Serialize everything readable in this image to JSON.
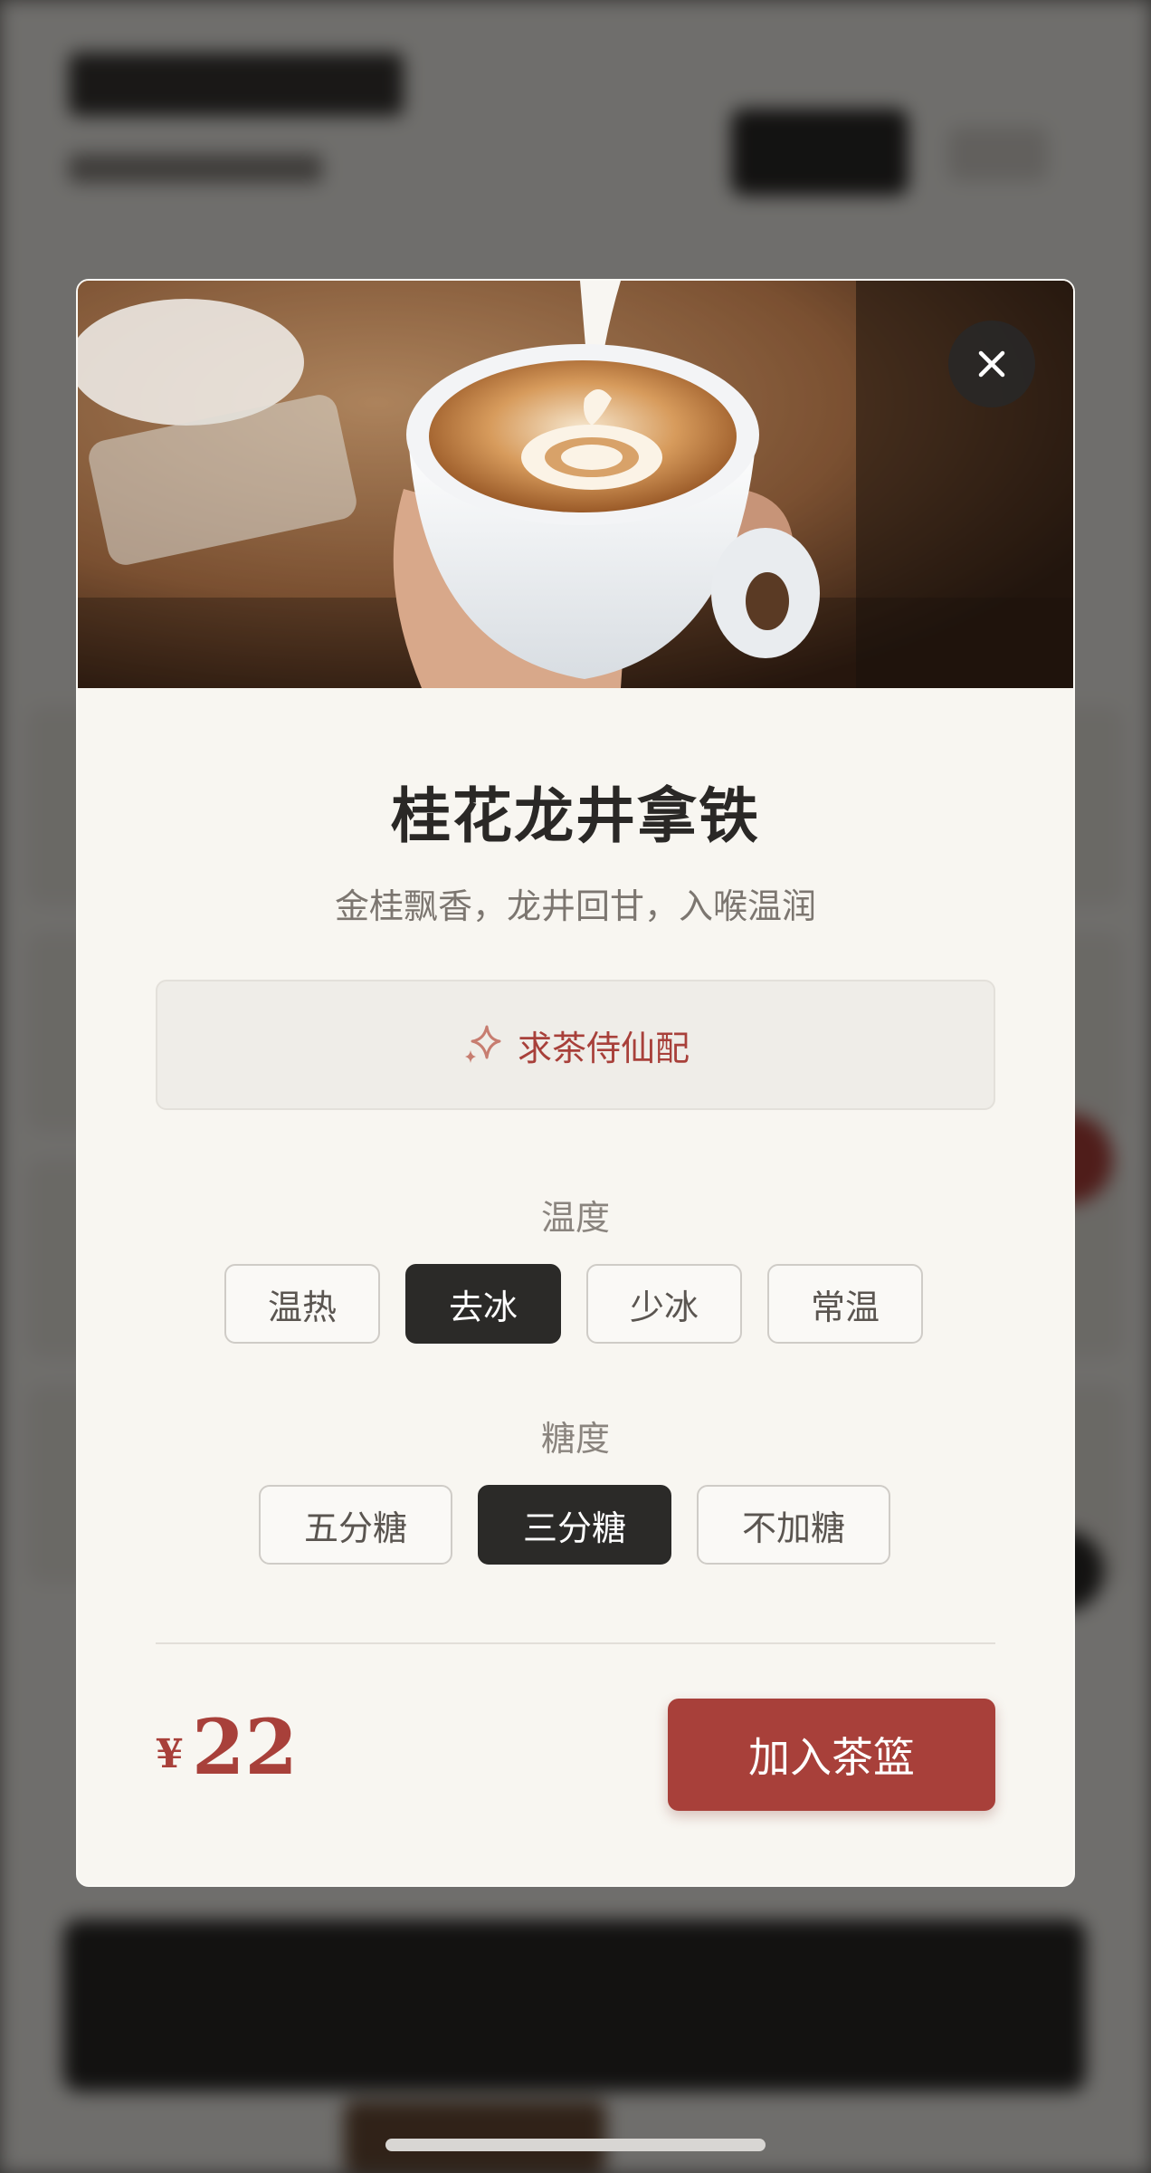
{
  "product": {
    "name": "桂花龙井拿铁",
    "description": "金桂飘香，龙井回甘，入喉温润",
    "ai_pairing_label": "求茶侍仙配",
    "ai_icon": "sparkle-icon",
    "hero_image": "latte-art-photo"
  },
  "temperature": {
    "label": "温度",
    "options": [
      "温热",
      "去冰",
      "少冰",
      "常温"
    ],
    "selected": "去冰"
  },
  "sugar": {
    "label": "糖度",
    "options": [
      "五分糖",
      "三分糖",
      "不加糖"
    ],
    "selected": "三分糖"
  },
  "price": {
    "currency": "¥",
    "value": "22"
  },
  "cart": {
    "add_label": "加入茶篮"
  },
  "colors": {
    "accent": "#a8403a",
    "selected_option": "#2b2a28",
    "modal_bg": "#f8f6f1"
  }
}
